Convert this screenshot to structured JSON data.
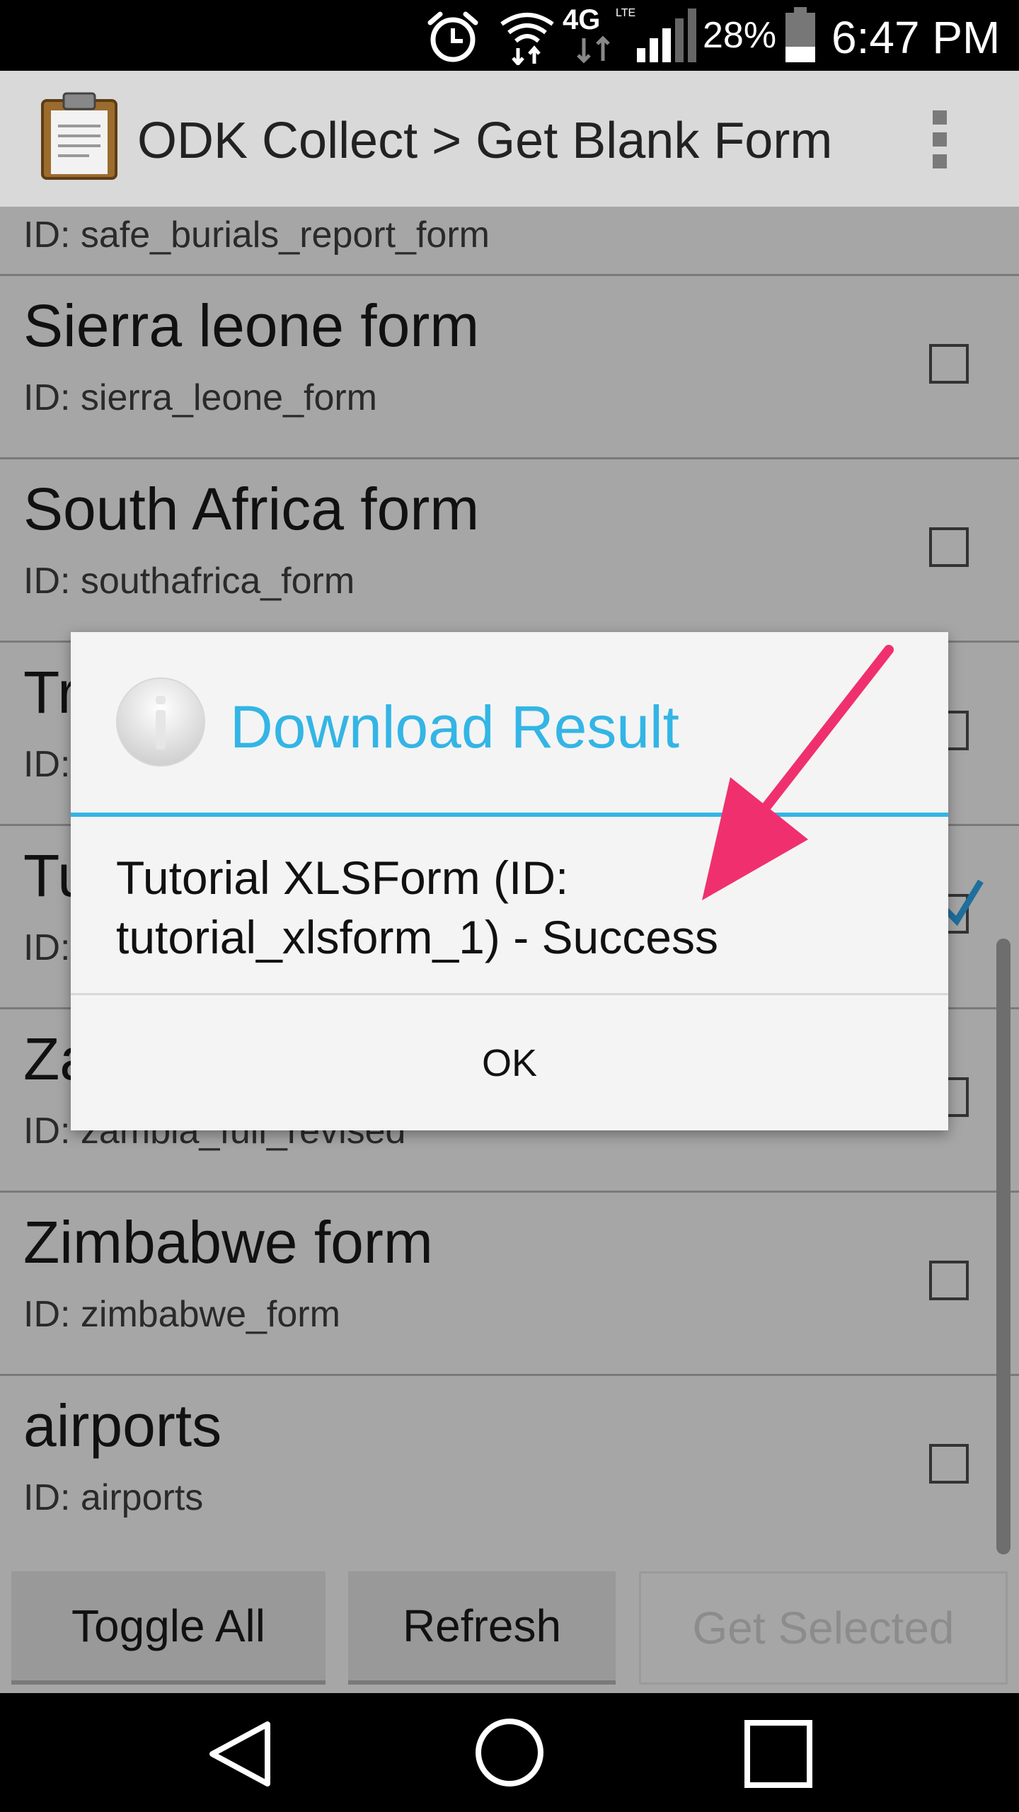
{
  "status_bar": {
    "network": "4G",
    "network_sub": "LTE",
    "battery_percent": "28%",
    "time": "6:47 PM",
    "icons": [
      "alarm-icon",
      "wifi-icon",
      "lte-icon",
      "signal-icon",
      "battery-icon"
    ]
  },
  "app_bar": {
    "title": "ODK Collect > Get Blank Form",
    "icon": "clipboard-icon",
    "overflow_icon": "more-vert-icon"
  },
  "form_list": [
    {
      "title": "",
      "id": "ID: safe_burials_report_form",
      "checked": false
    },
    {
      "title": "Sierra leone form",
      "id": "ID: sierra_leone_form",
      "checked": false
    },
    {
      "title": "South Africa form",
      "id": "ID: southafrica_form",
      "checked": false
    },
    {
      "title": "Tr",
      "id": "ID:",
      "checked": false
    },
    {
      "title": "Tu",
      "id": "ID:",
      "checked": true
    },
    {
      "title": "Za",
      "id": "ID: zambia_full_revised",
      "checked": false
    },
    {
      "title": "Zimbabwe form",
      "id": "ID: zimbabwe_form",
      "checked": false
    },
    {
      "title": "airports",
      "id": "ID: airports",
      "checked": false
    }
  ],
  "buttons": {
    "toggle_all": "Toggle All",
    "refresh": "Refresh",
    "get_selected": "Get Selected"
  },
  "dialog": {
    "title": "Download Result",
    "icon": "info-icon",
    "message": "Tutorial XLSForm (ID: tutorial_xlsform_1) - Success",
    "ok_label": "OK",
    "accent_color": "#33b5e5"
  },
  "annotation": {
    "arrow_color": "#f0306e"
  },
  "nav_bar": {
    "icons": [
      "back-icon",
      "home-icon",
      "recents-icon"
    ]
  }
}
